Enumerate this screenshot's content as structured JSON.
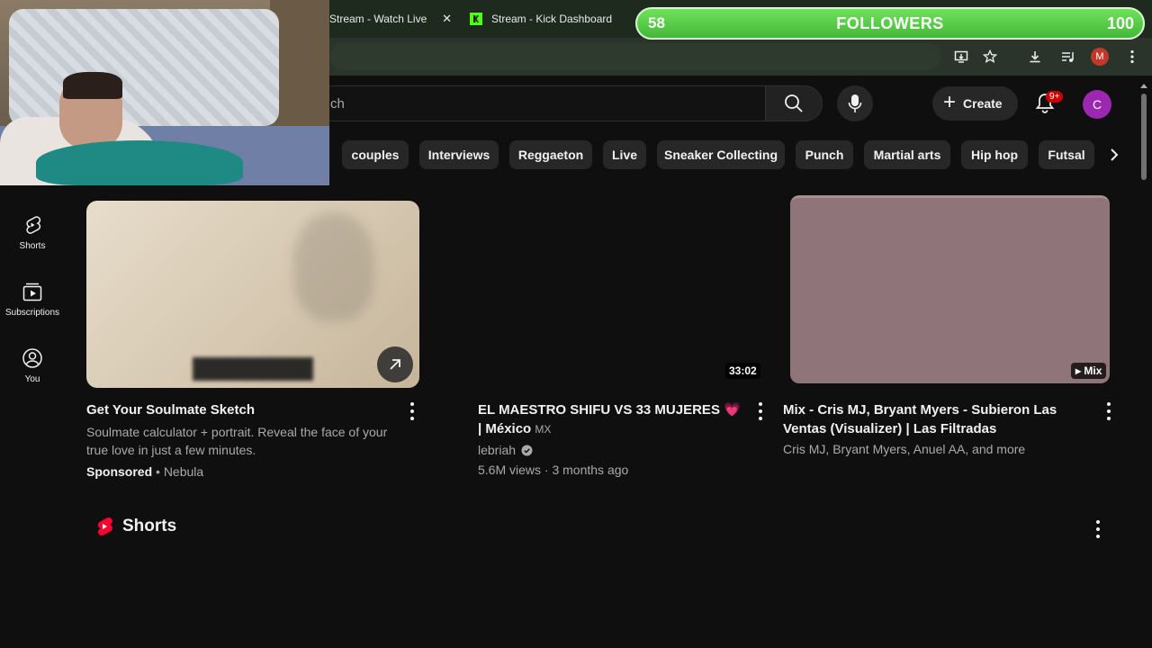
{
  "browser": {
    "tabs": [
      {
        "label": "Stream - Watch Live"
      },
      {
        "label": "Stream - Kick Dashboard"
      }
    ],
    "close_glyph": "✕",
    "window_controls": {
      "minimize": "—",
      "restore": "❐"
    },
    "profile_initial": "M"
  },
  "overlay": {
    "followers_current": "58",
    "followers_label": "FOLLOWERS",
    "followers_goal": "100"
  },
  "youtube": {
    "search_placeholder": "ch",
    "create_label": "Create",
    "notification_count": "9+",
    "account_initial": "C",
    "chips": [
      "couples",
      "Interviews",
      "Reggaeton",
      "Live",
      "Sneaker Collecting",
      "Punch",
      "Martial arts",
      "Hip hop",
      "Futsal"
    ],
    "sidebar": [
      {
        "label": "Shorts",
        "icon": "shorts-icon"
      },
      {
        "label": "Subscriptions",
        "icon": "subscriptions-icon"
      },
      {
        "label": "You",
        "icon": "you-icon"
      }
    ],
    "videos": [
      {
        "title": "Get Your Soulmate Sketch",
        "description": "Soulmate calculator + portrait. Reveal the face of your true love in just a few minutes.",
        "sponsored": "Sponsored",
        "advertiser": "Nebula"
      },
      {
        "title": "EL MAESTRO SHIFU VS 33 MUJERES 💗 | México",
        "title_suffix": "MX",
        "channel": "lebriah",
        "views": "5.6M views · 3 months ago",
        "duration": "33:02"
      },
      {
        "title": "Mix - Cris MJ, Bryant Myers - Subieron Las Ventas (Visualizer) | Las Filtradas",
        "artists": "Cris MJ, Bryant Myers, Anuel AA, and more",
        "badge": "Mix"
      }
    ],
    "shorts_heading": "Shorts"
  },
  "colors": {
    "background": "#0f0f0f",
    "chip": "#272727",
    "followers_green": "#43b838",
    "kick_green": "#53fc18",
    "youtube_red": "#ff0033",
    "account_purple": "#9c27b0"
  }
}
